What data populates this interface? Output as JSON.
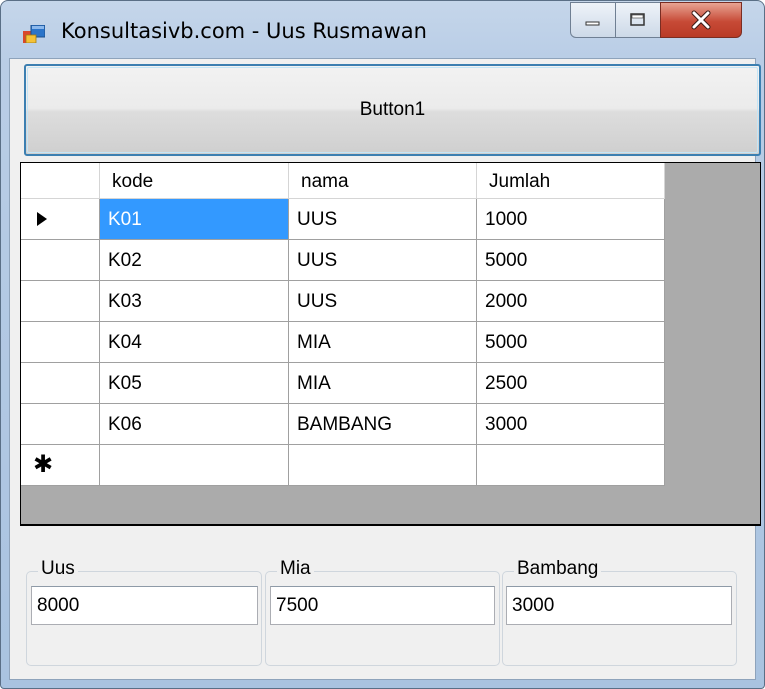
{
  "window": {
    "title": "Konsultasivb.com - Uus Rusmawan"
  },
  "button1": {
    "label": "Button1"
  },
  "grid": {
    "columns": [
      "kode",
      "nama",
      "Jumlah"
    ],
    "rows": [
      [
        "K01",
        "UUS",
        "1000"
      ],
      [
        "K02",
        "UUS",
        "5000"
      ],
      [
        "K03",
        "UUS",
        "2000"
      ],
      [
        "K04",
        "MIA",
        "5000"
      ],
      [
        "K05",
        "MIA",
        "2500"
      ],
      [
        "K06",
        "BAMBANG",
        "3000"
      ]
    ],
    "current_row_glyph": "▶",
    "new_row_glyph": "✱"
  },
  "groups": [
    {
      "label": "Uus",
      "value": "8000"
    },
    {
      "label": "Mia",
      "value": "7500"
    },
    {
      "label": "Bambang",
      "value": "3000"
    }
  ],
  "icons": {
    "app": "app-window-icon",
    "minimize": "minimize-icon",
    "maximize": "maximize-icon",
    "close": "close-icon"
  },
  "colors": {
    "selection": "#3399ff",
    "grid_background": "#ababab",
    "close_button": "#c74a36",
    "button_border": "#3c7fb1"
  }
}
